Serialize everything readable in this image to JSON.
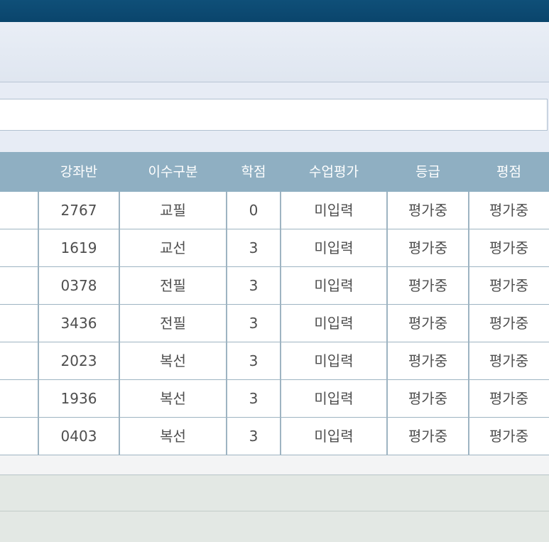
{
  "colors": {
    "topbar": "#0a456c",
    "header_bg": "#8fafc2",
    "grid_line": "#9eb4c2",
    "panel_bg": "#e7ecf5"
  },
  "table": {
    "headers": {
      "section": "강좌반",
      "category": "이수구분",
      "credits": "학점",
      "evaluation": "수업평가",
      "grade": "등급",
      "score": "평점"
    },
    "rows": [
      {
        "section": "2767",
        "category": "교필",
        "credits": "0",
        "evaluation": "미입력",
        "grade": "평가중",
        "score": "평가중"
      },
      {
        "section": "1619",
        "category": "교선",
        "credits": "3",
        "evaluation": "미입력",
        "grade": "평가중",
        "score": "평가중"
      },
      {
        "section": "0378",
        "category": "전필",
        "credits": "3",
        "evaluation": "미입력",
        "grade": "평가중",
        "score": "평가중"
      },
      {
        "section": "3436",
        "category": "전필",
        "credits": "3",
        "evaluation": "미입력",
        "grade": "평가중",
        "score": "평가중"
      },
      {
        "section": "2023",
        "category": "복선",
        "credits": "3",
        "evaluation": "미입력",
        "grade": "평가중",
        "score": "평가중"
      },
      {
        "section": "1936",
        "category": "복선",
        "credits": "3",
        "evaluation": "미입력",
        "grade": "평가중",
        "score": "평가중"
      },
      {
        "section": "0403",
        "category": "복선",
        "credits": "3",
        "evaluation": "미입력",
        "grade": "평가중",
        "score": "평가중"
      }
    ]
  }
}
